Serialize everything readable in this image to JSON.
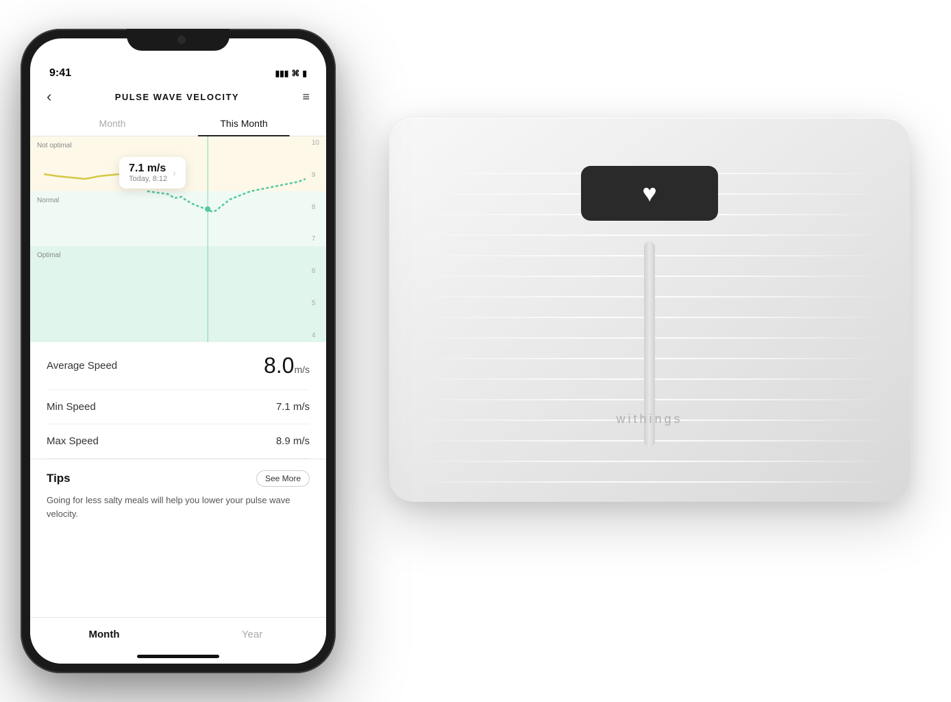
{
  "scene": {
    "background": "#ffffff"
  },
  "phone": {
    "status_bar": {
      "time": "9:41",
      "signal": "●●●●",
      "wifi": "WiFi",
      "battery": "Battery"
    },
    "header": {
      "back_label": "‹",
      "title": "PULSE WAVE VELOCITY",
      "menu_label": "≡"
    },
    "tabs": [
      {
        "label": "Month",
        "active": false
      },
      {
        "label": "This Month",
        "active": true
      }
    ],
    "chart": {
      "zones": [
        {
          "label": "Not optimal",
          "position": "top"
        },
        {
          "label": "Normal",
          "position": "middle"
        },
        {
          "label": "Optimal",
          "position": "bottom"
        }
      ],
      "y_labels": [
        "10",
        "9",
        "8",
        "7",
        "6",
        "5",
        "4"
      ],
      "tooltip": {
        "value": "7.1 m/s",
        "subtitle": "Today, 8:12",
        "arrow": "›"
      }
    },
    "stats": [
      {
        "label": "Average Speed",
        "value": "8.0",
        "unit": "m/s",
        "large": true
      },
      {
        "label": "Min Speed",
        "value": "7.1 m/s",
        "large": false
      },
      {
        "label": "Max Speed",
        "value": "8.9 m/s",
        "large": false
      }
    ],
    "tips": {
      "title": "Tips",
      "see_more_label": "See More",
      "text": "Going for less salty meals will help you lower your pulse wave velocity."
    },
    "bottom_tabs": [
      {
        "label": "Month",
        "active": true
      },
      {
        "label": "Year",
        "active": false
      }
    ],
    "home_indicator": true
  },
  "scale": {
    "brand": "withings",
    "display_icon": "♥",
    "ridges_count": 18
  }
}
